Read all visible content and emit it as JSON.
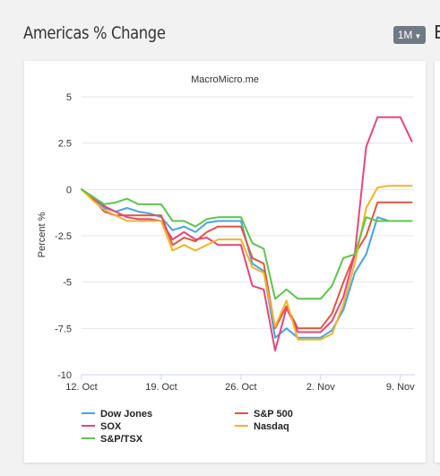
{
  "header": {
    "title": "Americas % Change",
    "range_label": "1M",
    "next_title": "E"
  },
  "chart_data": {
    "type": "line",
    "source": "MacroMicro.me",
    "ylabel": "Percent %",
    "ylim": [
      -10,
      5
    ],
    "yticks": [
      5,
      2.5,
      0,
      -2.5,
      -5,
      -7.5,
      -10
    ],
    "ytick_labels": [
      "5",
      "2.5",
      "0",
      "-2.5",
      "-5",
      "-7.5",
      "-10"
    ],
    "xlim": [
      0,
      29.2
    ],
    "xticks": [
      0,
      7,
      14,
      21,
      28
    ],
    "xtick_labels": [
      "12. Oct",
      "19. Oct",
      "26. Oct",
      "2. Nov",
      "9. Nov"
    ],
    "x": [
      0,
      1,
      2,
      3,
      4,
      5,
      6,
      7,
      8,
      9,
      10,
      11,
      12,
      13,
      14,
      15,
      16,
      17,
      18,
      19,
      20,
      21,
      22,
      23,
      24,
      25,
      26,
      27,
      28,
      29
    ],
    "grid": true,
    "legend_position": "bottom",
    "series": [
      {
        "name": "Dow Jones",
        "color": "#4aa3df",
        "values": [
          0,
          -0.5,
          -1.0,
          -1.2,
          -1.0,
          -1.2,
          -1.3,
          -1.5,
          -2.2,
          -2.0,
          -2.3,
          -1.8,
          -1.7,
          -1.7,
          -1.7,
          -4.0,
          -4.4,
          -8.0,
          -7.5,
          -8.0,
          -8.0,
          -8.0,
          -7.6,
          -6.5,
          -4.5,
          -3.5,
          -1.5,
          -1.7,
          -1.7,
          -1.7
        ]
      },
      {
        "name": "S&P 500",
        "color": "#e0553a",
        "values": [
          0,
          -0.5,
          -1.2,
          -1.4,
          -1.4,
          -1.4,
          -1.4,
          -1.4,
          -3.0,
          -2.6,
          -2.8,
          -2.3,
          -2.0,
          -2.0,
          -2.0,
          -3.7,
          -4.0,
          -7.5,
          -6.3,
          -7.5,
          -7.5,
          -7.5,
          -6.7,
          -5.0,
          -3.5,
          -2.5,
          -0.7,
          -0.7,
          -0.7,
          -0.7
        ]
      },
      {
        "name": "SOX",
        "color": "#e5467a",
        "values": [
          0,
          -0.4,
          -0.9,
          -1.2,
          -1.5,
          -1.6,
          -1.6,
          -1.7,
          -2.7,
          -2.3,
          -2.7,
          -2.6,
          -3.0,
          -3.0,
          -3.0,
          -5.2,
          -5.4,
          -8.7,
          -6.4,
          -7.7,
          -7.7,
          -7.7,
          -7.1,
          -5.8,
          -3.5,
          2.3,
          3.9,
          3.9,
          3.9,
          2.6
        ]
      },
      {
        "name": "Nasdaq",
        "color": "#f0b429",
        "values": [
          0,
          -0.6,
          -1.1,
          -1.4,
          -1.7,
          -1.7,
          -1.7,
          -1.7,
          -3.3,
          -3.0,
          -3.3,
          -3.0,
          -2.7,
          -2.7,
          -2.7,
          -4.2,
          -4.5,
          -7.4,
          -6.0,
          -8.1,
          -8.1,
          -8.1,
          -7.8,
          -6.2,
          -4.0,
          -1.0,
          0.1,
          0.2,
          0.2,
          0.2
        ]
      },
      {
        "name": "S&P/TSX",
        "color": "#5dc44c",
        "values": [
          0,
          -0.4,
          -0.8,
          -0.7,
          -0.5,
          -0.8,
          -0.8,
          -0.8,
          -1.7,
          -1.7,
          -2.0,
          -1.6,
          -1.5,
          -1.5,
          -1.5,
          -2.9,
          -3.2,
          -5.9,
          -5.4,
          -5.9,
          -5.9,
          -5.9,
          -5.2,
          -3.7,
          -3.5,
          -1.5,
          -1.7,
          -1.7,
          -1.7,
          -1.7
        ]
      }
    ]
  }
}
